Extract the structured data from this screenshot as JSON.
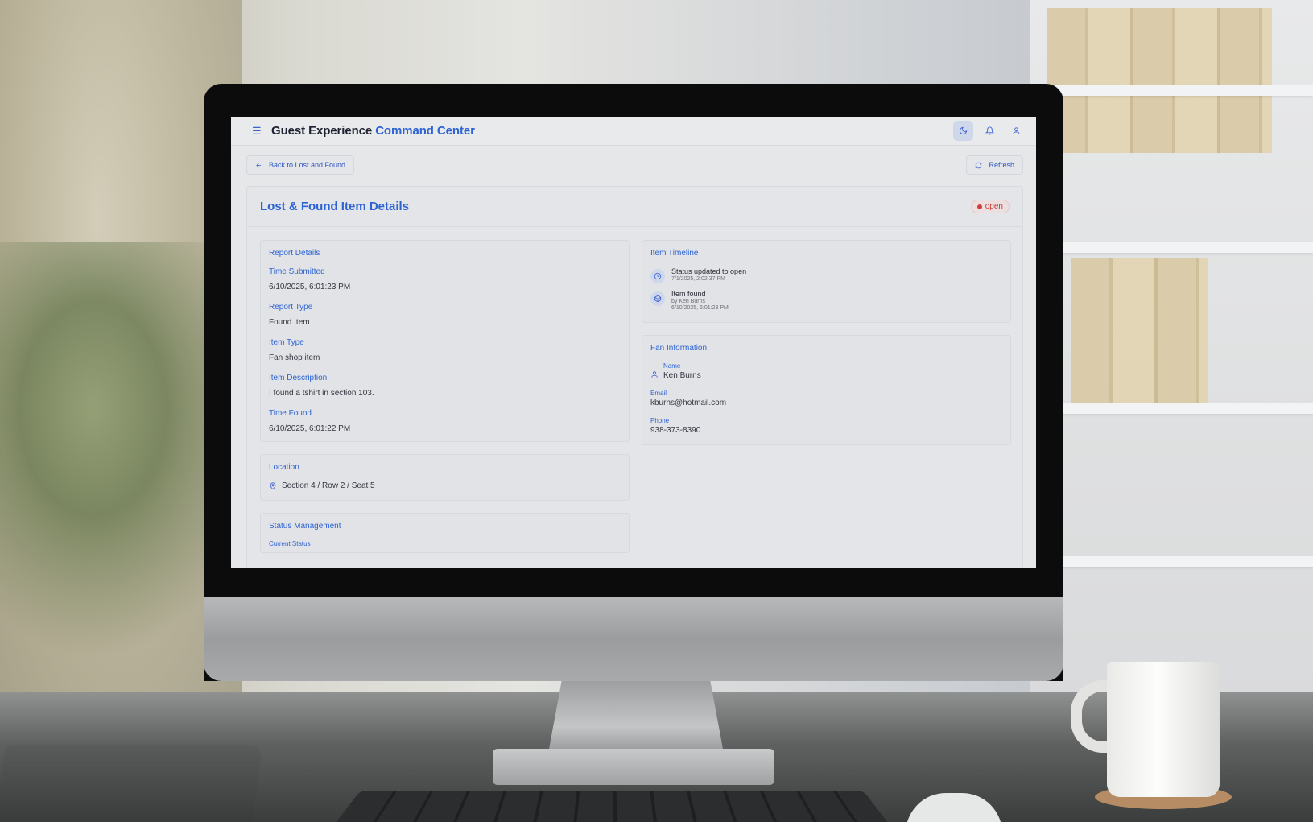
{
  "app": {
    "title_main": "Guest Experience",
    "title_accent": "Command Center"
  },
  "topbar": {
    "icons": [
      "moon-icon",
      "bell-icon",
      "user-icon"
    ]
  },
  "actions": {
    "back_label": "Back to Lost and Found",
    "refresh_label": "Refresh"
  },
  "card": {
    "title": "Lost & Found Item Details",
    "status": "open"
  },
  "report_details": {
    "title": "Report Details",
    "fields": [
      {
        "label": "Time Submitted",
        "value": "6/10/2025, 6:01:23 PM"
      },
      {
        "label": "Report Type",
        "value": "Found Item"
      },
      {
        "label": "Item Type",
        "value": "Fan shop item"
      },
      {
        "label": "Item Description",
        "value": "I found a tshirt in section 103."
      },
      {
        "label": "Time Found",
        "value": "6/10/2025, 6:01:22 PM"
      }
    ]
  },
  "location": {
    "title": "Location",
    "value": "Section 4 / Row 2 / Seat 5"
  },
  "status_management": {
    "title": "Status Management",
    "current_status_label": "Current Status"
  },
  "timeline": {
    "title": "Item Timeline",
    "items": [
      {
        "title": "Status updated to open",
        "by": "",
        "time": "7/1/2025, 2:02:37 PM",
        "icon": "clock-icon"
      },
      {
        "title": "Item found",
        "by": "by Ken Burns",
        "time": "6/10/2025, 6:01:23 PM",
        "icon": "box-icon"
      }
    ]
  },
  "fan_info": {
    "title": "Fan Information",
    "name_label": "Name",
    "name": "Ken Burns",
    "email_label": "Email",
    "email": "kburns@hotmail.com",
    "phone_label": "Phone",
    "phone": "938-373-8390"
  },
  "colors": {
    "accent": "#2d63d3",
    "status_open": "#d43b3b"
  }
}
